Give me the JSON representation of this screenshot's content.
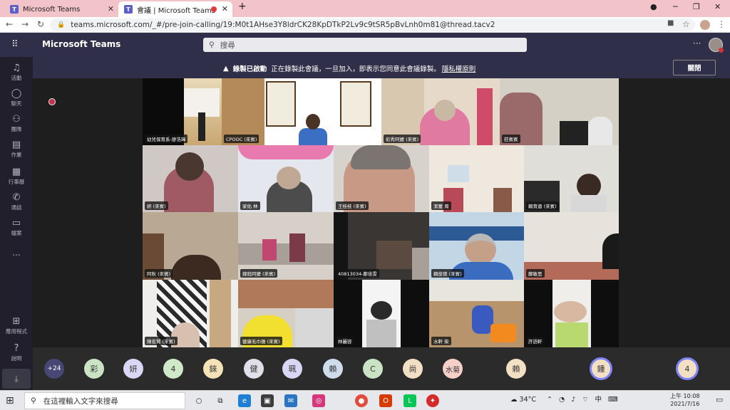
{
  "browser": {
    "tabs": [
      {
        "title": "Microsoft Teams",
        "icon": "teams-icon",
        "active": false
      },
      {
        "title": "會議 | Microsoft Teams",
        "icon": "teams-icon",
        "active": true,
        "recording": true
      }
    ],
    "url": "teams.microsoft.com/_#/pre-join-calling/19:M0t1AHse3Y8ldrCK28KpDTkP2Lv9c9tSR5pBvLnh0m81@thread.tacv2"
  },
  "teams": {
    "app_title": "Microsoft Teams",
    "search_placeholder": "搜尋",
    "rail": [
      {
        "label": "活動",
        "icon": "bell-icon"
      },
      {
        "label": "聊天",
        "icon": "chat-icon"
      },
      {
        "label": "團隊",
        "icon": "teams-icon"
      },
      {
        "label": "作業",
        "icon": "assignments-icon"
      },
      {
        "label": "行事曆",
        "icon": "calendar-icon"
      },
      {
        "label": "通話",
        "icon": "phone-icon"
      },
      {
        "label": "檔案",
        "icon": "files-icon"
      },
      {
        "label": "...",
        "icon": "more-icon"
      },
      {
        "label": "應用程式",
        "icon": "apps-icon"
      },
      {
        "label": "說明",
        "icon": "help-icon"
      }
    ],
    "recording_banner": {
      "title": "錄製已啟動",
      "message": "正在錄製此會議，一旦加入，即表示您同意此會議錄製。",
      "link": "隱私權原則",
      "close_label": "關閉"
    }
  },
  "participants": [
    {
      "name": "幼兒保育系-廖浩瑋"
    },
    {
      "name": "CPOOC (來賓)"
    },
    {
      "name": "彩秀阿嬤 (來賓)"
    },
    {
      "name": "莊賓賓"
    },
    {
      "name": "妍 (來賓)"
    },
    {
      "name": "家佑 林"
    },
    {
      "name": "王桂枝 (來賓)"
    },
    {
      "name": "潔蕾 周"
    },
    {
      "name": "賴育遠 (來賓)"
    },
    {
      "name": "阿秋 (來賓)"
    },
    {
      "name": "錦鈺阿嬤 (來賓)"
    },
    {
      "name": "40813034-鄭佳雯"
    },
    {
      "name": "賴俊德 (來賓)"
    },
    {
      "name": "鄭敏思"
    },
    {
      "name": "陳名賢 (來賓)"
    },
    {
      "name": "健康毛巾操 (來賓)"
    },
    {
      "name": "林麗容"
    },
    {
      "name": "水軒 柴"
    },
    {
      "name": "許語軒"
    }
  ],
  "avatar_strip": [
    {
      "label": "+24",
      "color": "#464775",
      "text_color": "#ffffff"
    },
    {
      "label": "彩",
      "color": "#c9e3c4"
    },
    {
      "label": "妍",
      "color": "#d8d7f5"
    },
    {
      "label": "4",
      "color": "#cfe8c8"
    },
    {
      "label": "錸",
      "color": "#f5e3b8"
    },
    {
      "label": "健",
      "color": "#dfe0ea"
    },
    {
      "label": "珮",
      "color": "#d8d7f5"
    },
    {
      "label": "賴",
      "color": "#cfdcec"
    },
    {
      "label": "C",
      "color": "#c9e3c4"
    },
    {
      "label": "尚",
      "color": "#f3dfc4"
    },
    {
      "label": "水菊",
      "color": "#f6d0c8"
    },
    {
      "label": "賴",
      "color": "#f3dfc4"
    },
    {
      "label": "鍾",
      "color": "#f3dfc4",
      "ring": true
    },
    {
      "label": "4",
      "color": "#f3dfc4",
      "ring": true
    }
  ],
  "taskbar": {
    "search_placeholder": "在這裡輸入文字來搜尋",
    "weather": "34°C",
    "ime": "中",
    "time": "上午 10:08",
    "date": "2021/7/16"
  }
}
